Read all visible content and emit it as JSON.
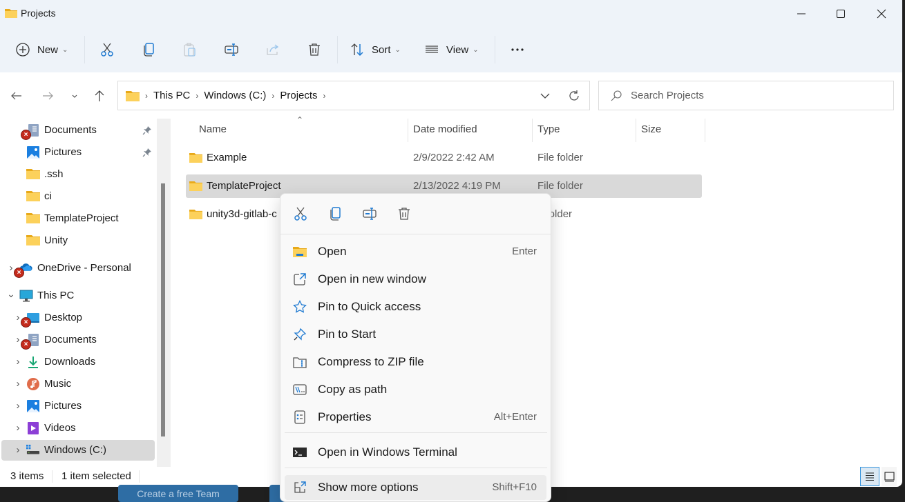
{
  "window": {
    "title": "Projects",
    "controls": {
      "minimize": "minimize",
      "maximize": "maximize",
      "close": "close"
    }
  },
  "toolbar": {
    "new_label": "New",
    "sort_label": "Sort",
    "view_label": "View",
    "buttons": [
      "cut",
      "copy",
      "paste",
      "rename",
      "share",
      "delete"
    ]
  },
  "address": {
    "crumbs": [
      "This PC",
      "Windows (C:)",
      "Projects"
    ]
  },
  "search": {
    "placeholder": "Search Projects"
  },
  "sidebar": {
    "items": [
      {
        "label": "Documents",
        "icon": "documents",
        "pinned": true,
        "error": true
      },
      {
        "label": "Pictures",
        "icon": "pictures",
        "pinned": true
      },
      {
        "label": ".ssh",
        "icon": "folder"
      },
      {
        "label": "ci",
        "icon": "folder"
      },
      {
        "label": "TemplateProject",
        "icon": "folder"
      },
      {
        "label": "Unity",
        "icon": "folder"
      },
      {
        "label": "OneDrive - Personal",
        "icon": "onedrive",
        "expandable": true,
        "error": true
      },
      {
        "label": "This PC",
        "icon": "pc",
        "expanded": true
      },
      {
        "label": "Desktop",
        "icon": "desktop",
        "expandable": true,
        "error": true
      },
      {
        "label": "Documents",
        "icon": "documents",
        "expandable": true,
        "error": true
      },
      {
        "label": "Downloads",
        "icon": "downloads",
        "expandable": true
      },
      {
        "label": "Music",
        "icon": "music",
        "expandable": true
      },
      {
        "label": "Pictures",
        "icon": "pictures",
        "expandable": true
      },
      {
        "label": "Videos",
        "icon": "videos",
        "expandable": true
      },
      {
        "label": "Windows (C:)",
        "icon": "drive",
        "expandable": true,
        "selected": true
      }
    ]
  },
  "filelist": {
    "columns": [
      "Name",
      "Date modified",
      "Type",
      "Size"
    ],
    "sort_indicator": "ascending",
    "rows": [
      {
        "name": "Example",
        "date": "2/9/2022 2:42 AM",
        "type": "File folder",
        "size": ""
      },
      {
        "name": "TemplateProject",
        "date": "2/13/2022 4:19 PM",
        "type": "File folder",
        "size": "",
        "selected": true
      },
      {
        "name": "unity3d-gitlab-c",
        "date": "",
        "type": "e folder",
        "size": ""
      }
    ]
  },
  "status": {
    "item_count": "3 items",
    "selection": "1 item selected"
  },
  "context_menu": {
    "quick_actions": [
      "cut",
      "copy",
      "rename",
      "delete"
    ],
    "items": [
      {
        "label": "Open",
        "shortcut": "Enter",
        "icon": "folder-open"
      },
      {
        "label": "Open in new window",
        "shortcut": "",
        "icon": "open-new-window"
      },
      {
        "label": "Pin to Quick access",
        "shortcut": "",
        "icon": "star"
      },
      {
        "label": "Pin to Start",
        "shortcut": "",
        "icon": "pin"
      },
      {
        "label": "Compress to ZIP file",
        "shortcut": "",
        "icon": "zip"
      },
      {
        "label": "Copy as path",
        "shortcut": "",
        "icon": "copy-path"
      },
      {
        "label": "Properties",
        "shortcut": "Alt+Enter",
        "icon": "properties"
      },
      {
        "label": "Open in Windows Terminal",
        "shortcut": "",
        "icon": "terminal"
      },
      {
        "label": "Show more options",
        "shortcut": "Shift+F10",
        "icon": "more-options"
      }
    ]
  },
  "background": {
    "taskbar_button": "Create a free Team"
  },
  "colors": {
    "accent": "#0067c0",
    "folder": "#f8c33a",
    "selection": "#d9d9d9",
    "error": "#c42b1c"
  }
}
